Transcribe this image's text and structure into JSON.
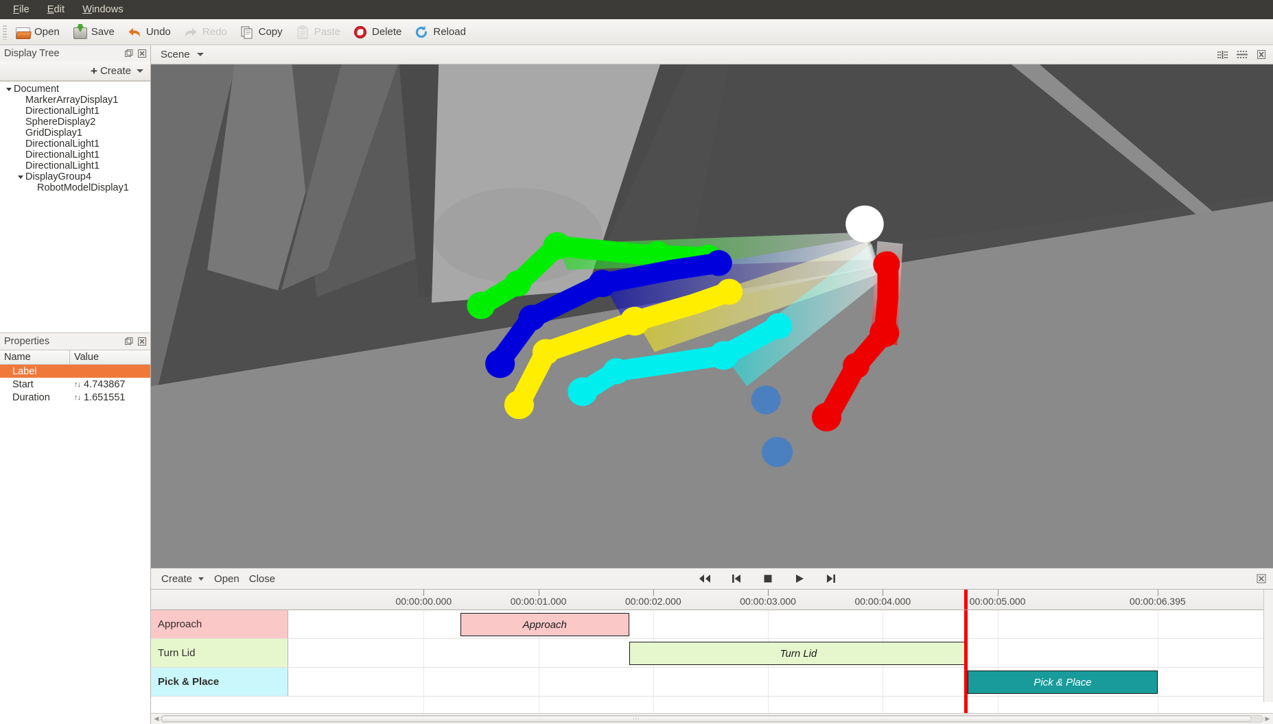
{
  "menubar": {
    "items": [
      {
        "label": "File",
        "accel": "F"
      },
      {
        "label": "Edit",
        "accel": "E"
      },
      {
        "label": "Windows",
        "accel": "W"
      }
    ]
  },
  "toolbar": {
    "items": [
      {
        "label": "Open",
        "icon": "folder-open-icon",
        "enabled": true
      },
      {
        "label": "Save",
        "icon": "save-disk-icon",
        "enabled": true
      },
      {
        "label": "Undo",
        "icon": "undo-arrow-icon",
        "enabled": true
      },
      {
        "label": "Redo",
        "icon": "redo-arrow-icon",
        "enabled": false
      },
      {
        "label": "Copy",
        "icon": "copy-icon",
        "enabled": true
      },
      {
        "label": "Paste",
        "icon": "paste-icon",
        "enabled": false
      },
      {
        "label": "Delete",
        "icon": "delete-forbidden-icon",
        "enabled": true
      },
      {
        "label": "Reload",
        "icon": "reload-refresh-icon",
        "enabled": true
      }
    ]
  },
  "display_tree": {
    "title": "Display Tree",
    "create_label": "Create",
    "nodes": [
      {
        "label": "Document",
        "indent": 0,
        "expanded": true
      },
      {
        "label": "MarkerArrayDisplay1",
        "indent": 1,
        "expanded": null
      },
      {
        "label": "DirectionalLight1",
        "indent": 1,
        "expanded": null
      },
      {
        "label": "SphereDisplay2",
        "indent": 1,
        "expanded": null
      },
      {
        "label": "GridDisplay1",
        "indent": 1,
        "expanded": null
      },
      {
        "label": "DirectionalLight1",
        "indent": 1,
        "expanded": null
      },
      {
        "label": "DirectionalLight1",
        "indent": 1,
        "expanded": null
      },
      {
        "label": "DirectionalLight1",
        "indent": 1,
        "expanded": null
      },
      {
        "label": "DisplayGroup4",
        "indent": 1,
        "expanded": true
      },
      {
        "label": "RobotModelDisplay1",
        "indent": 2,
        "expanded": null
      }
    ]
  },
  "properties": {
    "title": "Properties",
    "columns": {
      "name": "Name",
      "value": "Value"
    },
    "rows": [
      {
        "name": "Label",
        "value": "",
        "selected": true,
        "stepper": false
      },
      {
        "name": "Start",
        "value": "4.743867",
        "selected": false,
        "stepper": true
      },
      {
        "name": "Duration",
        "value": "1.651551",
        "selected": false,
        "stepper": true
      }
    ]
  },
  "scene": {
    "tab_label": "Scene",
    "tools": [
      {
        "name": "split-vertical-icon"
      },
      {
        "name": "split-horizontal-icon"
      },
      {
        "name": "close-view-icon"
      }
    ]
  },
  "timeline": {
    "toolbar": {
      "create_label": "Create",
      "open_label": "Open",
      "close_label": "Close"
    },
    "transport": [
      {
        "name": "rewind-button",
        "glyph": "rewind"
      },
      {
        "name": "skip-to-start-button",
        "glyph": "skip-start"
      },
      {
        "name": "stop-button",
        "glyph": "stop"
      },
      {
        "name": "play-button",
        "glyph": "play"
      },
      {
        "name": "skip-to-end-button",
        "glyph": "skip-end"
      }
    ],
    "close_icon": "close-timeline-icon",
    "ruler": {
      "ticks": [
        {
          "label": "00:00:00.000",
          "t": 0.0
        },
        {
          "label": "00:00:01.000",
          "t": 1.0
        },
        {
          "label": "00:00:02.000",
          "t": 2.0
        },
        {
          "label": "00:00:03.000",
          "t": 3.0
        },
        {
          "label": "00:00:04.000",
          "t": 4.0
        },
        {
          "label": "00:00:05.000",
          "t": 5.0
        },
        {
          "label": "00:00:06.395",
          "t": 6.395
        }
      ],
      "range_start": -1.18,
      "range_end": 7.4
    },
    "playhead_time": 4.72,
    "playhead_color": "#f40000",
    "tracks": [
      {
        "label": "Approach",
        "header_color": "#fbc8c8",
        "clip_color": "#fbc8c8",
        "clip_label": "Approach",
        "clip_start": 0.32,
        "clip_end": 1.79,
        "selected": false,
        "text_color": "#1a1a1a"
      },
      {
        "label": "Turn Lid",
        "header_color": "#e6f7cd",
        "clip_color": "#e6f7cd",
        "clip_label": "Turn Lid",
        "clip_start": 1.79,
        "clip_end": 4.74,
        "selected": false,
        "text_color": "#1a1a1a"
      },
      {
        "label": "Pick & Place",
        "header_color": "#c9f7fb",
        "clip_color": "#1a9b9b",
        "clip_label": "Pick & Place",
        "clip_start": 4.74,
        "clip_end": 6.395,
        "selected": true,
        "text_color": "#ffffff"
      }
    ]
  },
  "viewport": {
    "background_color": "#8a8a8a",
    "trajectory_colors": [
      "#00ee00",
      "#0000dd",
      "#ffee00",
      "#00eeee",
      "#ee0000"
    ],
    "joint_marker_color": "#ffffff",
    "target_sphere_color": "#4b80c0"
  }
}
